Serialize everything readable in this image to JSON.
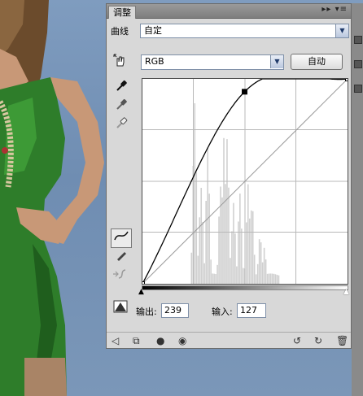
{
  "panel": {
    "tab_label": "调整",
    "preset_label": "曲线",
    "preset_value": "自定",
    "channel_value": "RGB",
    "auto_button": "自动",
    "output_label": "输出:",
    "output_value": "239",
    "input_label": "输入:",
    "input_value": "127",
    "titlebar_icons": "▸▸ ▾≡"
  },
  "curve": {
    "input_range": [
      0,
      255
    ],
    "output_range": [
      0,
      255
    ],
    "control_points": [
      [
        0,
        0
      ],
      [
        127,
        239
      ],
      [
        255,
        255
      ]
    ],
    "selected_point": [
      127,
      239
    ]
  },
  "colors": {
    "panel_bg": "#d8d8d8",
    "graph_bg": "#ffffff",
    "grid": "#b8b8b8",
    "histogram": "#d0d0d0",
    "curve": "#000000"
  },
  "icons": {
    "on_image_adjust": "hand-arrows-icon",
    "eyedropper_black": "eyedropper-black-icon",
    "eyedropper_gray": "eyedropper-gray-icon",
    "eyedropper_white": "eyedropper-white-icon",
    "curve_tool": "curve-tool-icon",
    "pencil_tool": "pencil-icon",
    "smooth_tool": "smooth-icon",
    "clipping_warning": "clipping-warning-icon",
    "back": "back-arrow-icon",
    "clip_to_layer": "clip-layer-icon",
    "layer_visibility_dot": "visibility-dot-icon",
    "eye": "eye-icon",
    "view_previous": "view-previous-icon",
    "reset": "reset-icon",
    "trash": "trash-icon"
  }
}
